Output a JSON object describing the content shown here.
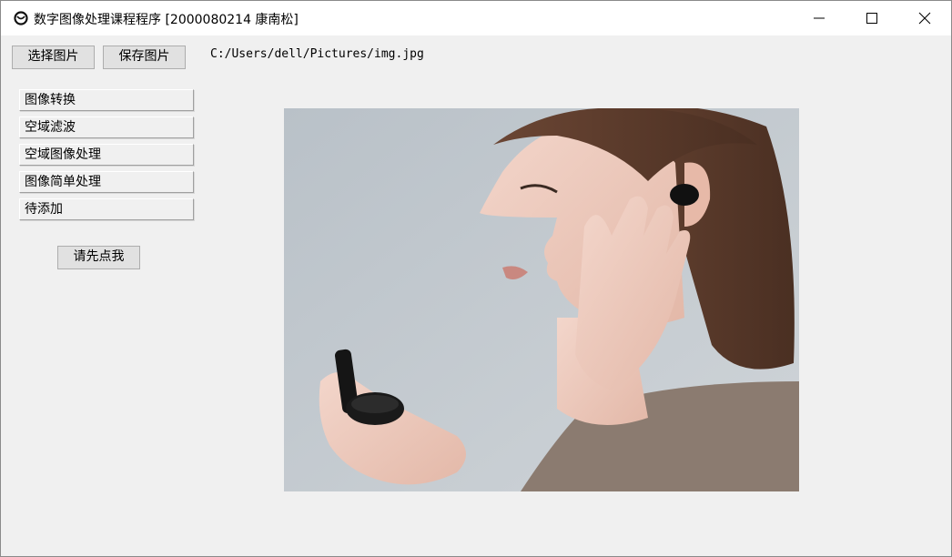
{
  "window": {
    "title": "数字图像处理课程程序 [2000080214 康南松]",
    "controls": [
      "minimize",
      "maximize",
      "close"
    ]
  },
  "toolbar": {
    "select_label": "选择图片",
    "save_label": "保存图片",
    "path": "C:/Users/dell/Pictures/img.jpg"
  },
  "menu": {
    "items": [
      {
        "label": "图像转换"
      },
      {
        "label": "空域滤波"
      },
      {
        "label": "空域图像处理"
      },
      {
        "label": "图像简单处理"
      },
      {
        "label": "待添加"
      }
    ],
    "first_label": "请先点我"
  },
  "image": {
    "icon": "photo-woman-earbuds"
  },
  "colors": {
    "background": "#f0f0f0",
    "titlebar": "#ffffff",
    "button_face": "#e1e1e1",
    "button_border": "#adadad"
  }
}
